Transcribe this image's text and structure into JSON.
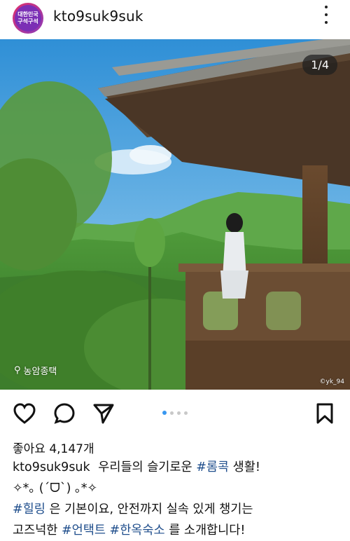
{
  "header": {
    "avatar_text_line1": "대한민국",
    "avatar_text_line2": "구석구석",
    "username": "kto9suk9suk",
    "more_icon": "more-vertical-icon"
  },
  "photo": {
    "counter": "1/4",
    "location": "농암종택",
    "credit": "©yk_94",
    "slide_index": 1,
    "slide_total": 4
  },
  "actions": {
    "like_icon": "heart-icon",
    "comment_icon": "comment-icon",
    "share_icon": "send-icon",
    "save_icon": "bookmark-icon",
    "active_color": "#3897f0"
  },
  "likes_text": "좋아요 4,147개",
  "caption": {
    "username": "kto9suk9suk",
    "line1_text": "우리들의 슬기로운",
    "line1_tag": "#롬콕",
    "line1_end": "생활!",
    "line2": "✧*｡ (ˊᗜˋ) ｡*✧",
    "line3_tag": "#힐링",
    "line3_text": "은 기본이요, 안전까지 실속 있게 챙기는",
    "line4_text": "고즈넉한",
    "line4_tag1": "#언택트",
    "line4_tag2": "#한옥숙소",
    "line4_end": "를 소개합니다!"
  }
}
